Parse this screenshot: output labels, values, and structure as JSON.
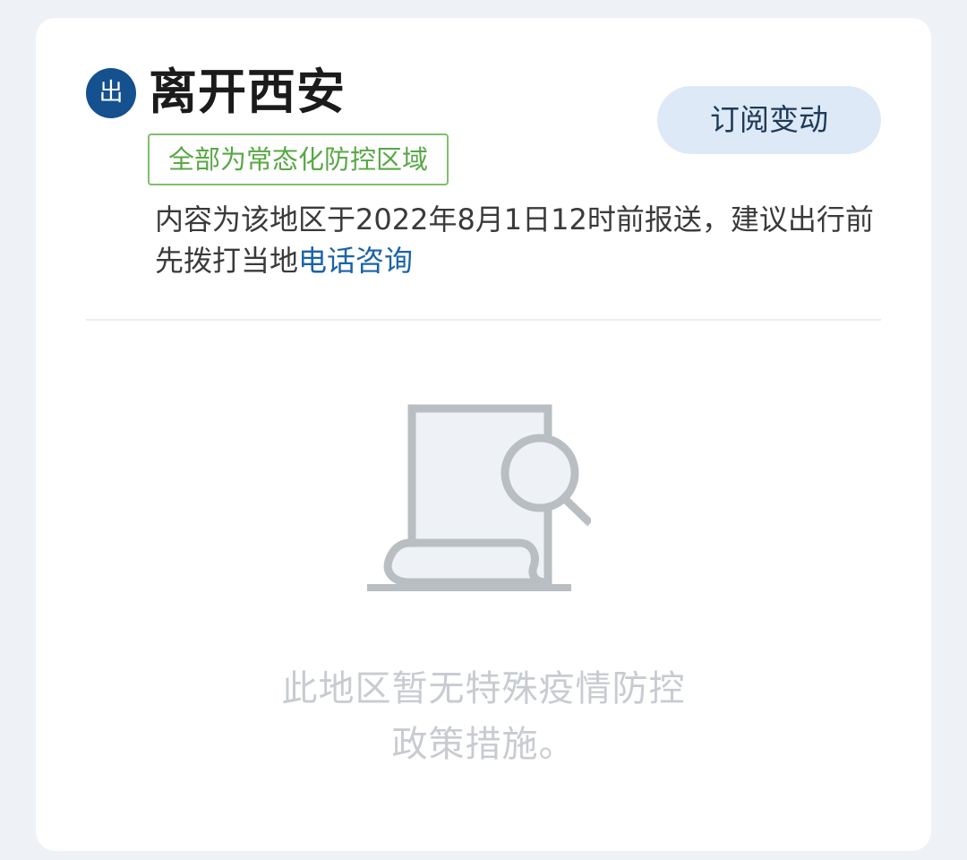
{
  "header": {
    "badge": "出",
    "title": "离开西安",
    "subscribe_label": "订阅变动",
    "zone_tag": "全部为常态化防控区域"
  },
  "notice": {
    "text": "内容为该地区于2022年8月1日12时前报送，建议出行前先拨打当地",
    "link_text": "电话咨询"
  },
  "empty_state": {
    "icon": "document-search-icon",
    "line1": "此地区暂无特殊疫情防控",
    "line2": "政策措施。"
  },
  "colors": {
    "badge": "#15508f",
    "tag_green": "#58a845",
    "link_blue": "#1b63a8",
    "subscribe_bg": "#dde9f6"
  }
}
